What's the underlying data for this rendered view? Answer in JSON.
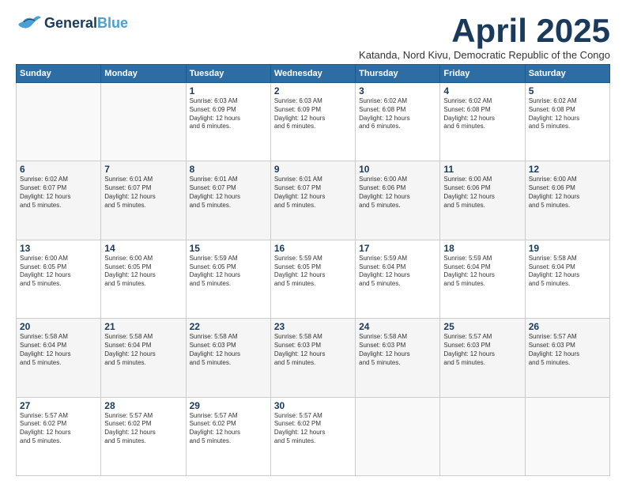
{
  "logo": {
    "part1": "General",
    "part2": "Blue"
  },
  "title": "April 2025",
  "subtitle": "Katanda, Nord Kivu, Democratic Republic of the Congo",
  "days_of_week": [
    "Sunday",
    "Monday",
    "Tuesday",
    "Wednesday",
    "Thursday",
    "Friday",
    "Saturday"
  ],
  "weeks": [
    {
      "shaded": false,
      "days": [
        {
          "num": "",
          "info": ""
        },
        {
          "num": "",
          "info": ""
        },
        {
          "num": "1",
          "info": "Sunrise: 6:03 AM\nSunset: 6:09 PM\nDaylight: 12 hours\nand 6 minutes."
        },
        {
          "num": "2",
          "info": "Sunrise: 6:03 AM\nSunset: 6:09 PM\nDaylight: 12 hours\nand 6 minutes."
        },
        {
          "num": "3",
          "info": "Sunrise: 6:02 AM\nSunset: 6:08 PM\nDaylight: 12 hours\nand 6 minutes."
        },
        {
          "num": "4",
          "info": "Sunrise: 6:02 AM\nSunset: 6:08 PM\nDaylight: 12 hours\nand 6 minutes."
        },
        {
          "num": "5",
          "info": "Sunrise: 6:02 AM\nSunset: 6:08 PM\nDaylight: 12 hours\nand 5 minutes."
        }
      ]
    },
    {
      "shaded": true,
      "days": [
        {
          "num": "6",
          "info": "Sunrise: 6:02 AM\nSunset: 6:07 PM\nDaylight: 12 hours\nand 5 minutes."
        },
        {
          "num": "7",
          "info": "Sunrise: 6:01 AM\nSunset: 6:07 PM\nDaylight: 12 hours\nand 5 minutes."
        },
        {
          "num": "8",
          "info": "Sunrise: 6:01 AM\nSunset: 6:07 PM\nDaylight: 12 hours\nand 5 minutes."
        },
        {
          "num": "9",
          "info": "Sunrise: 6:01 AM\nSunset: 6:07 PM\nDaylight: 12 hours\nand 5 minutes."
        },
        {
          "num": "10",
          "info": "Sunrise: 6:00 AM\nSunset: 6:06 PM\nDaylight: 12 hours\nand 5 minutes."
        },
        {
          "num": "11",
          "info": "Sunrise: 6:00 AM\nSunset: 6:06 PM\nDaylight: 12 hours\nand 5 minutes."
        },
        {
          "num": "12",
          "info": "Sunrise: 6:00 AM\nSunset: 6:06 PM\nDaylight: 12 hours\nand 5 minutes."
        }
      ]
    },
    {
      "shaded": false,
      "days": [
        {
          "num": "13",
          "info": "Sunrise: 6:00 AM\nSunset: 6:05 PM\nDaylight: 12 hours\nand 5 minutes."
        },
        {
          "num": "14",
          "info": "Sunrise: 6:00 AM\nSunset: 6:05 PM\nDaylight: 12 hours\nand 5 minutes."
        },
        {
          "num": "15",
          "info": "Sunrise: 5:59 AM\nSunset: 6:05 PM\nDaylight: 12 hours\nand 5 minutes."
        },
        {
          "num": "16",
          "info": "Sunrise: 5:59 AM\nSunset: 6:05 PM\nDaylight: 12 hours\nand 5 minutes."
        },
        {
          "num": "17",
          "info": "Sunrise: 5:59 AM\nSunset: 6:04 PM\nDaylight: 12 hours\nand 5 minutes."
        },
        {
          "num": "18",
          "info": "Sunrise: 5:59 AM\nSunset: 6:04 PM\nDaylight: 12 hours\nand 5 minutes."
        },
        {
          "num": "19",
          "info": "Sunrise: 5:58 AM\nSunset: 6:04 PM\nDaylight: 12 hours\nand 5 minutes."
        }
      ]
    },
    {
      "shaded": true,
      "days": [
        {
          "num": "20",
          "info": "Sunrise: 5:58 AM\nSunset: 6:04 PM\nDaylight: 12 hours\nand 5 minutes."
        },
        {
          "num": "21",
          "info": "Sunrise: 5:58 AM\nSunset: 6:04 PM\nDaylight: 12 hours\nand 5 minutes."
        },
        {
          "num": "22",
          "info": "Sunrise: 5:58 AM\nSunset: 6:03 PM\nDaylight: 12 hours\nand 5 minutes."
        },
        {
          "num": "23",
          "info": "Sunrise: 5:58 AM\nSunset: 6:03 PM\nDaylight: 12 hours\nand 5 minutes."
        },
        {
          "num": "24",
          "info": "Sunrise: 5:58 AM\nSunset: 6:03 PM\nDaylight: 12 hours\nand 5 minutes."
        },
        {
          "num": "25",
          "info": "Sunrise: 5:57 AM\nSunset: 6:03 PM\nDaylight: 12 hours\nand 5 minutes."
        },
        {
          "num": "26",
          "info": "Sunrise: 5:57 AM\nSunset: 6:03 PM\nDaylight: 12 hours\nand 5 minutes."
        }
      ]
    },
    {
      "shaded": false,
      "days": [
        {
          "num": "27",
          "info": "Sunrise: 5:57 AM\nSunset: 6:02 PM\nDaylight: 12 hours\nand 5 minutes."
        },
        {
          "num": "28",
          "info": "Sunrise: 5:57 AM\nSunset: 6:02 PM\nDaylight: 12 hours\nand 5 minutes."
        },
        {
          "num": "29",
          "info": "Sunrise: 5:57 AM\nSunset: 6:02 PM\nDaylight: 12 hours\nand 5 minutes."
        },
        {
          "num": "30",
          "info": "Sunrise: 5:57 AM\nSunset: 6:02 PM\nDaylight: 12 hours\nand 5 minutes."
        },
        {
          "num": "",
          "info": ""
        },
        {
          "num": "",
          "info": ""
        },
        {
          "num": "",
          "info": ""
        }
      ]
    }
  ]
}
